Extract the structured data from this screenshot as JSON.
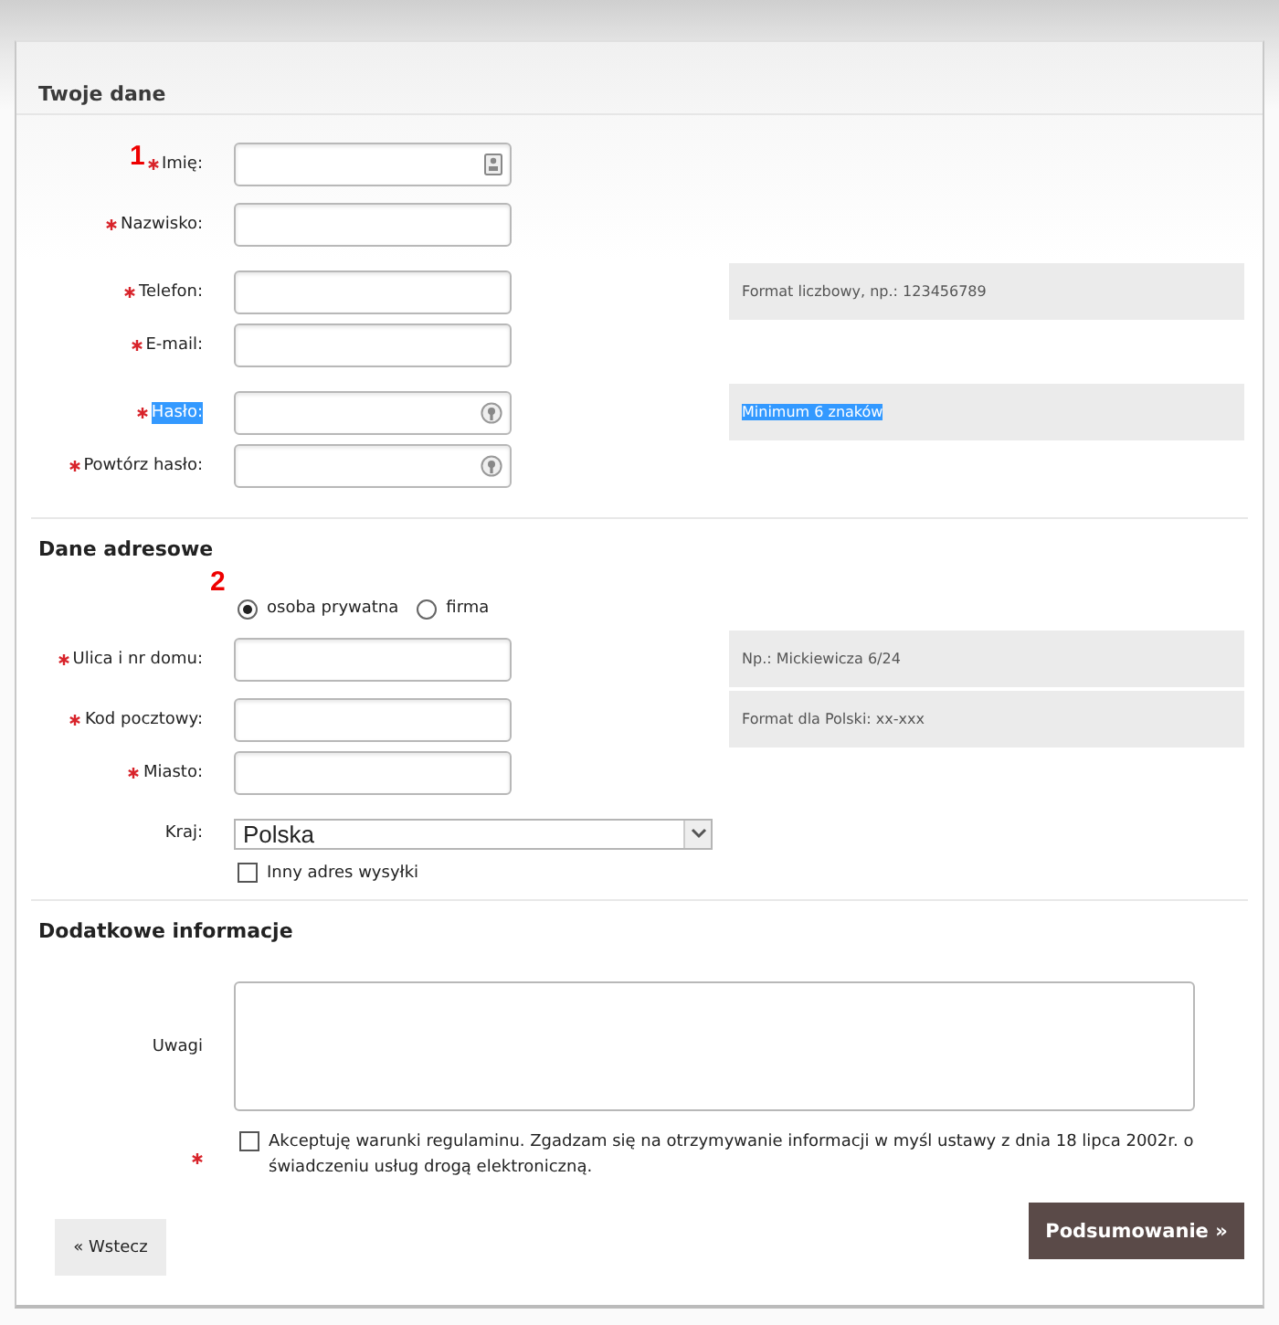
{
  "sections": [
    {
      "title": "Twoje dane",
      "kind": "personal",
      "fields": [
        {
          "label": "Imię:",
          "required": true,
          "kind": "id-card",
          "marker": "1",
          "highlighted": false
        },
        {
          "label": "Nazwisko:",
          "required": true,
          "kind": "text",
          "highlighted": false
        },
        {
          "label": "Telefon:",
          "required": true,
          "kind": "text",
          "highlighted": false,
          "hint": {
            "text": "Format liczbowy, np.: 123456789",
            "highlighted": false
          }
        },
        {
          "label": "E-mail:",
          "required": true,
          "kind": "text",
          "highlighted": false
        },
        {
          "label": "Hasło:",
          "required": true,
          "kind": "password",
          "highlighted": true,
          "hint": {
            "text": "Minimum 6 znaków",
            "highlighted": true
          }
        },
        {
          "label": "Powtórz hasło:",
          "required": true,
          "kind": "password",
          "highlighted": false
        }
      ]
    },
    {
      "title": "Dane adresowe",
      "kind": "address",
      "marker": "2",
      "radios": [
        {
          "label": "osoba prywatna",
          "selected": true
        },
        {
          "label": "firma",
          "selected": false
        }
      ],
      "fields": [
        {
          "label": "Ulica i nr domu:",
          "required": true,
          "kind": "text",
          "highlighted": false,
          "hint": {
            "text": "Np.: Mickiewicza 6/24",
            "highlighted": false
          }
        },
        {
          "label": "Kod pocztowy:",
          "required": true,
          "kind": "text",
          "highlighted": false,
          "hint": {
            "text": "Format dla Polski: xx-xxx",
            "highlighted": false
          }
        },
        {
          "label": "Miasto:",
          "required": true,
          "kind": "text",
          "highlighted": false
        },
        {
          "label": "Kraj:",
          "kind": "select",
          "value": "Polska",
          "highlighted": false
        }
      ],
      "checkbox": {
        "label": "Inny adres wysyłki",
        "checked": false
      }
    },
    {
      "title": "Dodatkowe informacje",
      "kind": "extra",
      "notes_label": "Uwagi",
      "terms": {
        "required": true,
        "checked": false,
        "text": "Akceptuję warunki regulaminu. Zgadzam się na otrzymywanie informacji w myśl ustawy z dnia 18 lipca 2002r. o świadczeniu usług drogą elektroniczną."
      }
    }
  ],
  "buttons": [
    {
      "label": "« Wstecz",
      "kind": "secondary"
    },
    {
      "label": "Podsumowanie »",
      "kind": "primary"
    }
  ]
}
